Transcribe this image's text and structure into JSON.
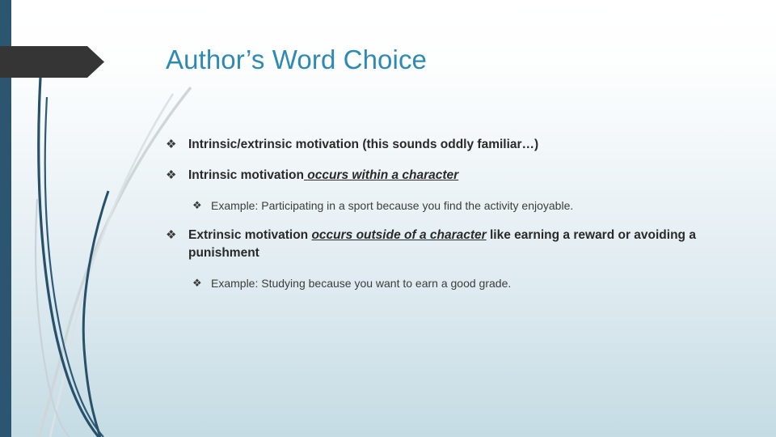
{
  "slide": {
    "title": "Author’s Word Choice",
    "title_color": "#2e8ab2",
    "background_top_color": "#ffffff",
    "background_bottom_color": "#c5dce4",
    "accent_bar_color": "#2c5570",
    "arrow_color": "#353535",
    "bullet_glyph": "❖",
    "body": [
      {
        "level": 1,
        "marker": "❖",
        "runs": [
          {
            "text": "Intrinsic/extrinsic motivation (this sounds oddly familiar…)",
            "style": "bold"
          }
        ]
      },
      {
        "level": 1,
        "marker": "❖",
        "runs": [
          {
            "text": "Intrinsic motivation",
            "style": "bold"
          },
          {
            "text": " ",
            "style": "bold-underline"
          },
          {
            "text": "occurs within a character",
            "style": "bold-italic-underline"
          }
        ]
      },
      {
        "level": 2,
        "marker": "❖",
        "runs": [
          {
            "text": "Example: Participating in a sport because you find the activity enjoyable.",
            "style": "regular"
          }
        ]
      },
      {
        "level": 1,
        "marker": "❖",
        "runs": [
          {
            "text": "Extrinsic motivation ",
            "style": "bold"
          },
          {
            "text": "occurs outside of a character",
            "style": "bold-italic-underline"
          },
          {
            "text": " like earning a reward or avoiding a punishment",
            "style": "bold"
          }
        ]
      },
      {
        "level": 2,
        "marker": "❖",
        "runs": [
          {
            "text": "Example: Studying because you want to earn a good grade.",
            "style": "regular"
          }
        ]
      }
    ]
  }
}
